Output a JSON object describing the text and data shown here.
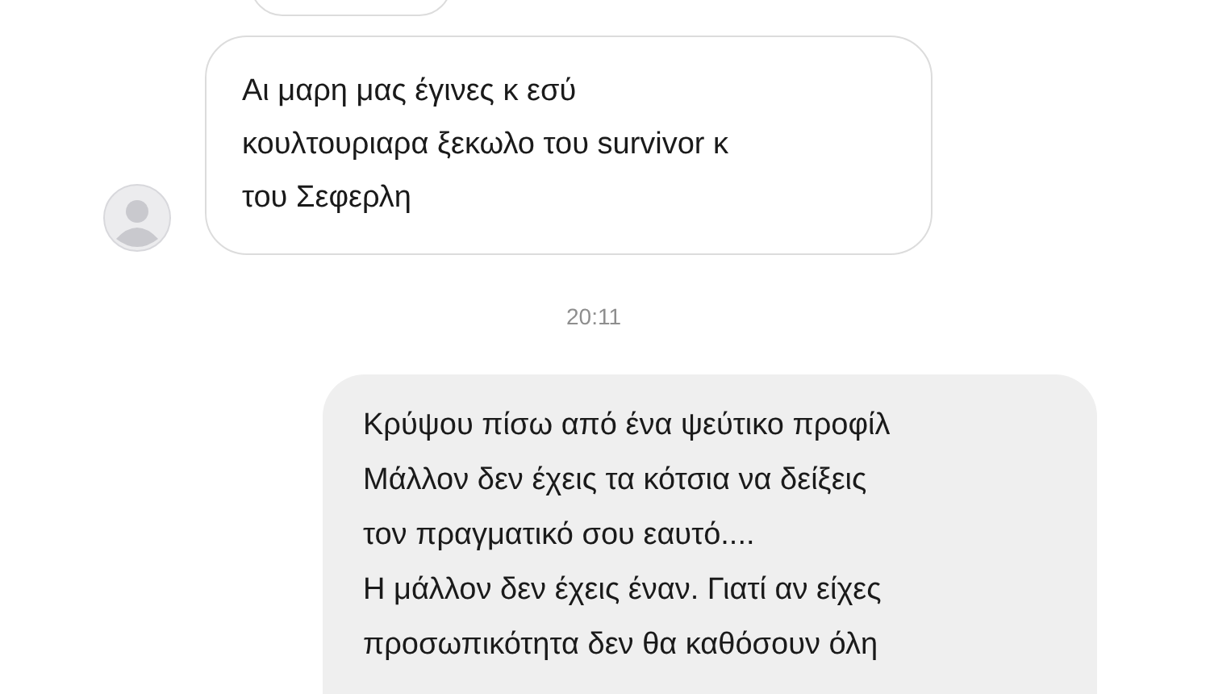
{
  "messages": [
    {
      "kind": "incoming",
      "text": "Αι μαρη μας έγινες κ εσύ\nκουλτουριαρα ξεκωλο του survivor κ\nτου Σεφερλη"
    },
    {
      "kind": "time",
      "text": "20:11"
    },
    {
      "kind": "outgoing",
      "text": "Κρύψου πίσω από ένα ψεύτικο προφίλ\nΜάλλον δεν έχεις τα κότσια να δείξεις\nτον πραγματικό σου εαυτό....\nΗ μάλλον δεν έχεις έναν. Γιατί αν είχες\nπροσωπικότητα δεν θα καθόσουν όλη"
    }
  ]
}
